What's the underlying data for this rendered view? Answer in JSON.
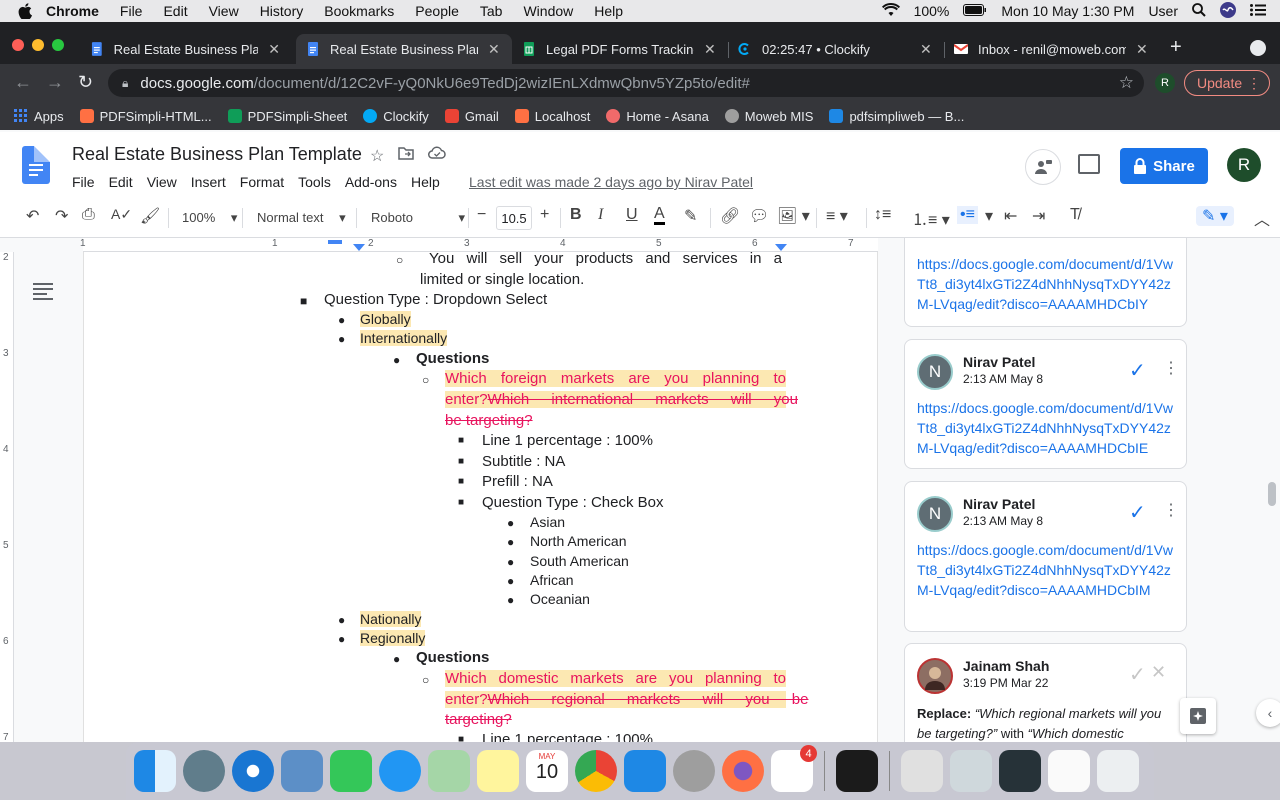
{
  "menubar": {
    "app": "Chrome",
    "items": [
      "File",
      "Edit",
      "View",
      "History",
      "Bookmarks",
      "People",
      "Tab",
      "Window",
      "Help"
    ],
    "battery": "100%",
    "datetime": "Mon 10 May  1:30 PM",
    "user": "User"
  },
  "tabs": [
    {
      "label": "Real Estate Business Plan T",
      "icon": "docs-icon",
      "active": false
    },
    {
      "label": "Real Estate Business Plan T",
      "icon": "docs-icon",
      "active": true
    },
    {
      "label": "Legal PDF Forms Tracking",
      "icon": "sheets-icon",
      "active": false
    },
    {
      "label": "02:25:47 • Clockify",
      "icon": "clockify-icon",
      "active": false
    },
    {
      "label": "Inbox - renil@moweb.com",
      "icon": "gmail-icon",
      "active": false
    }
  ],
  "address": {
    "host": "docs.google.com",
    "path": "/document/d/12C2vF-yQ0NkU6e9TedDj2wizIEnLXdmwQbnv5YZp5to/edit#",
    "profile_initial": "R",
    "update_label": "Update"
  },
  "bookmarks": [
    {
      "label": "Apps",
      "color": "#4285f4"
    },
    {
      "label": "PDFSimpli-HTML...",
      "color": "#ff7043"
    },
    {
      "label": "PDFSimpli-Sheet",
      "color": "#0f9d58"
    },
    {
      "label": "Clockify",
      "color": "#03a9f4"
    },
    {
      "label": "Gmail",
      "color": "#ea4335"
    },
    {
      "label": "Localhost",
      "color": "#ff7043"
    },
    {
      "label": "Home - Asana",
      "color": "#f06a6a"
    },
    {
      "label": "Moweb MIS",
      "color": "#9e9e9e"
    },
    {
      "label": "pdfsimpliweb — B...",
      "color": "#1e88e5"
    }
  ],
  "doc": {
    "title": "Real Estate Business Plan Template",
    "menu": [
      "File",
      "Edit",
      "View",
      "Insert",
      "Format",
      "Tools",
      "Add-ons",
      "Help"
    ],
    "last_edit": "Last edit was made 2 days ago by Nirav Patel",
    "share_label": "Share",
    "avatar_initial": "R"
  },
  "toolbar": {
    "zoom": "100%",
    "style": "Normal text",
    "font": "Roboto",
    "font_size": "10.5"
  },
  "ruler": [
    "1",
    "1",
    "2",
    "3",
    "4",
    "5",
    "6",
    "7"
  ],
  "vruler": [
    "2",
    "3",
    "4",
    "5",
    "6",
    "7"
  ],
  "content": {
    "line1a": "You will sell your products and services in a",
    "line1b": "limited or single location.",
    "qtype_dropdown": "Question Type : Dropdown Select",
    "globally": "Globally",
    "internationally": "Internationally",
    "questions1": "Questions",
    "q1_red1": "Which foreign markets are you planning to",
    "q1_red2": "enter?",
    "q1_strike1": "Which international markets will you",
    "q1_strike2": "be targeting?",
    "line1pct": "Line 1 percentage : 100%",
    "subtitle": "Subtitle : NA",
    "prefill": "Prefill : NA",
    "qtype_check": "Question Type : Check Box",
    "asian": "Asian",
    "north_american": "North American",
    "south_american": "South American",
    "african": "African",
    "oceanian": "Oceanian",
    "nationally": "Nationally",
    "regionally": "Regionally",
    "questions2": "Questions",
    "q2_red1": "Which domestic markets are you planning to",
    "q2_red2": "enter?",
    "q2_strike1": "Which regional markets will you be",
    "q2_strike2": "targeting?",
    "line1pct_partial": "Line 1 percentage : 100%"
  },
  "comments": [
    {
      "link": "https://docs.google.com/document/d/1VwTt8_di3yt4lxGTi2Z4dNhhNysqTxDYY42zM-LVqag/edit?disco=AAAAMHDCbIY"
    },
    {
      "author": "Nirav Patel",
      "time": "2:13 AM May 8",
      "initial": "N",
      "link": "https://docs.google.com/document/d/1VwTt8_di3yt4lxGTi2Z4dNhhNysqTxDYY42zM-LVqag/edit?disco=AAAAMHDCbIE"
    },
    {
      "author": "Nirav Patel",
      "time": "2:13 AM May 8",
      "initial": "N",
      "link": "https://docs.google.com/document/d/1VwTt8_di3yt4lxGTi2Z4dNhhNysqTxDYY42zM-LVqag/edit?disco=AAAAMHDCbIM"
    },
    {
      "author": "Jainam Shah",
      "time": "3:19 PM Mar 22",
      "replace_label": "Replace:",
      "replace_from": "“Which regional markets will you be targeting?”",
      "with_label": "with",
      "replace_to": "“Which domestic"
    }
  ],
  "dock": {
    "calendar_month": "MAY",
    "calendar_day": "10",
    "slack_badge": "4"
  }
}
